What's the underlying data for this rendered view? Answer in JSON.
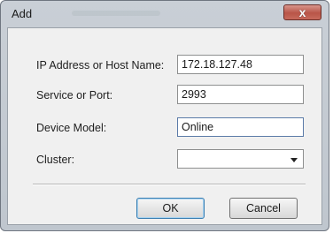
{
  "window": {
    "title": "Add",
    "close_glyph": "x",
    "close_icon": "close-icon"
  },
  "form": {
    "ip": {
      "label": "IP Address or Host Name:",
      "value": "172.18.127.48"
    },
    "port": {
      "label": "Service or Port:",
      "value": "2993"
    },
    "model": {
      "label": "Device Model:",
      "value": "Online"
    },
    "cluster": {
      "label": "Cluster:",
      "value": "",
      "dropdown_icon": "chevron-down-icon"
    }
  },
  "buttons": {
    "ok_label": "OK",
    "cancel_label": "Cancel"
  },
  "colors": {
    "close_button": "#b95548",
    "dialog_background": "#f0f0f0",
    "default_button_border": "#3c7fb1"
  }
}
